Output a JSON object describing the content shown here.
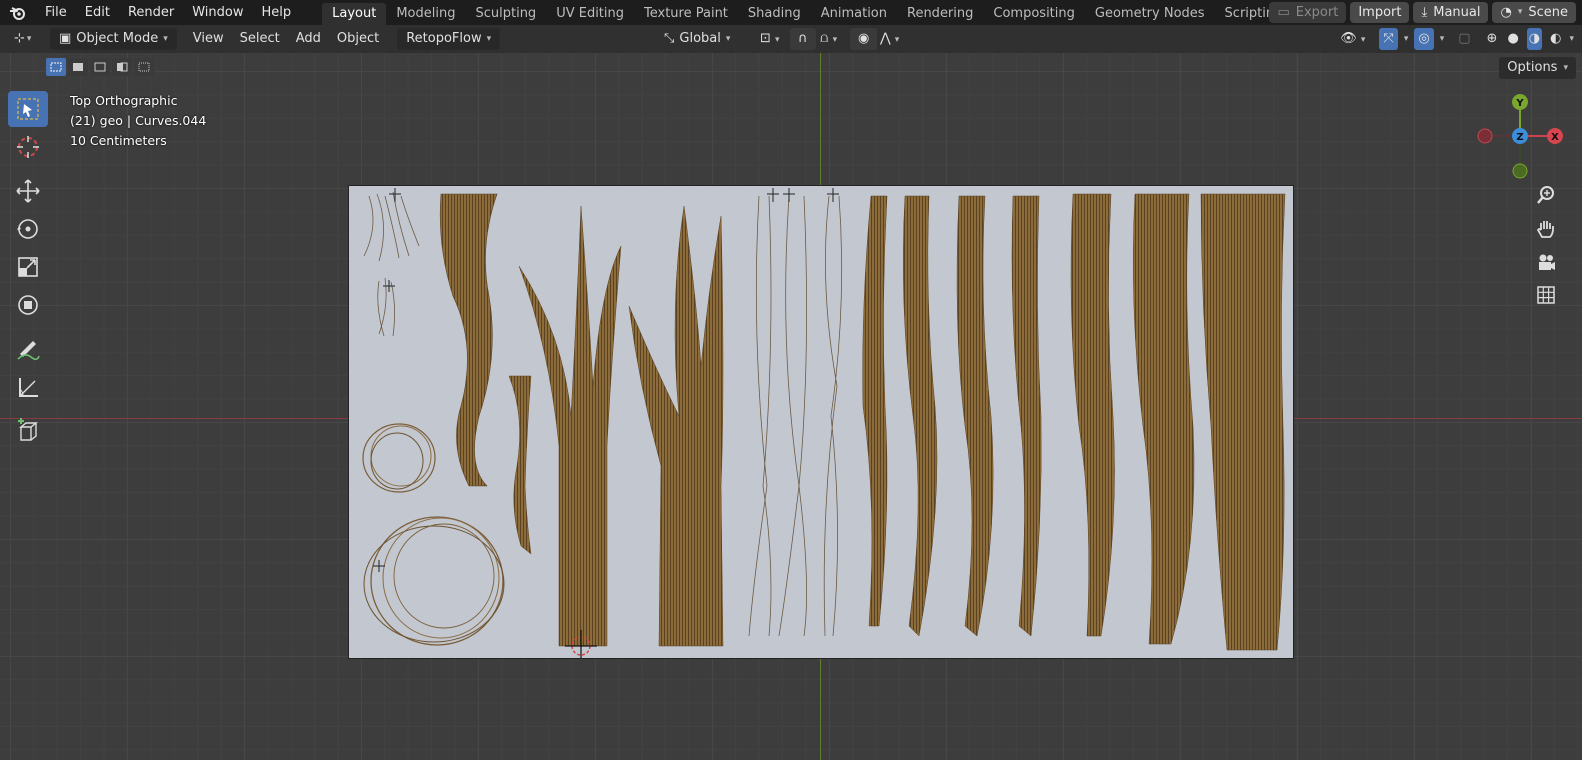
{
  "menu": [
    "File",
    "Edit",
    "Render",
    "Window",
    "Help"
  ],
  "workspaces": [
    {
      "label": "Layout",
      "active": true
    },
    {
      "label": "Modeling"
    },
    {
      "label": "Sculpting"
    },
    {
      "label": "UV Editing"
    },
    {
      "label": "Texture Paint"
    },
    {
      "label": "Shading"
    },
    {
      "label": "Animation"
    },
    {
      "label": "Rendering"
    },
    {
      "label": "Compositing"
    },
    {
      "label": "Geometry Nodes"
    },
    {
      "label": "Scripting"
    }
  ],
  "top_right": {
    "export": "Export",
    "import": "Import",
    "manual": "Manual",
    "scene": "Scene"
  },
  "header": {
    "mode": "Object Mode",
    "view": "View",
    "select": "Select",
    "add": "Add",
    "object": "Object",
    "addon": "RetopoFlow",
    "orientation": "Global"
  },
  "viewport": {
    "view_name": "Top Orthographic",
    "object_info": "(21) geo | Curves.044",
    "scale": "10 Centimeters",
    "options": "Options"
  },
  "gizmo": {
    "x": "X",
    "y": "Y",
    "z": "Z"
  },
  "colors": {
    "accent": "#4772b3",
    "hair": "#8a6a3a",
    "axis_x": "#8a3b42",
    "axis_y": "#5f7d2f"
  }
}
